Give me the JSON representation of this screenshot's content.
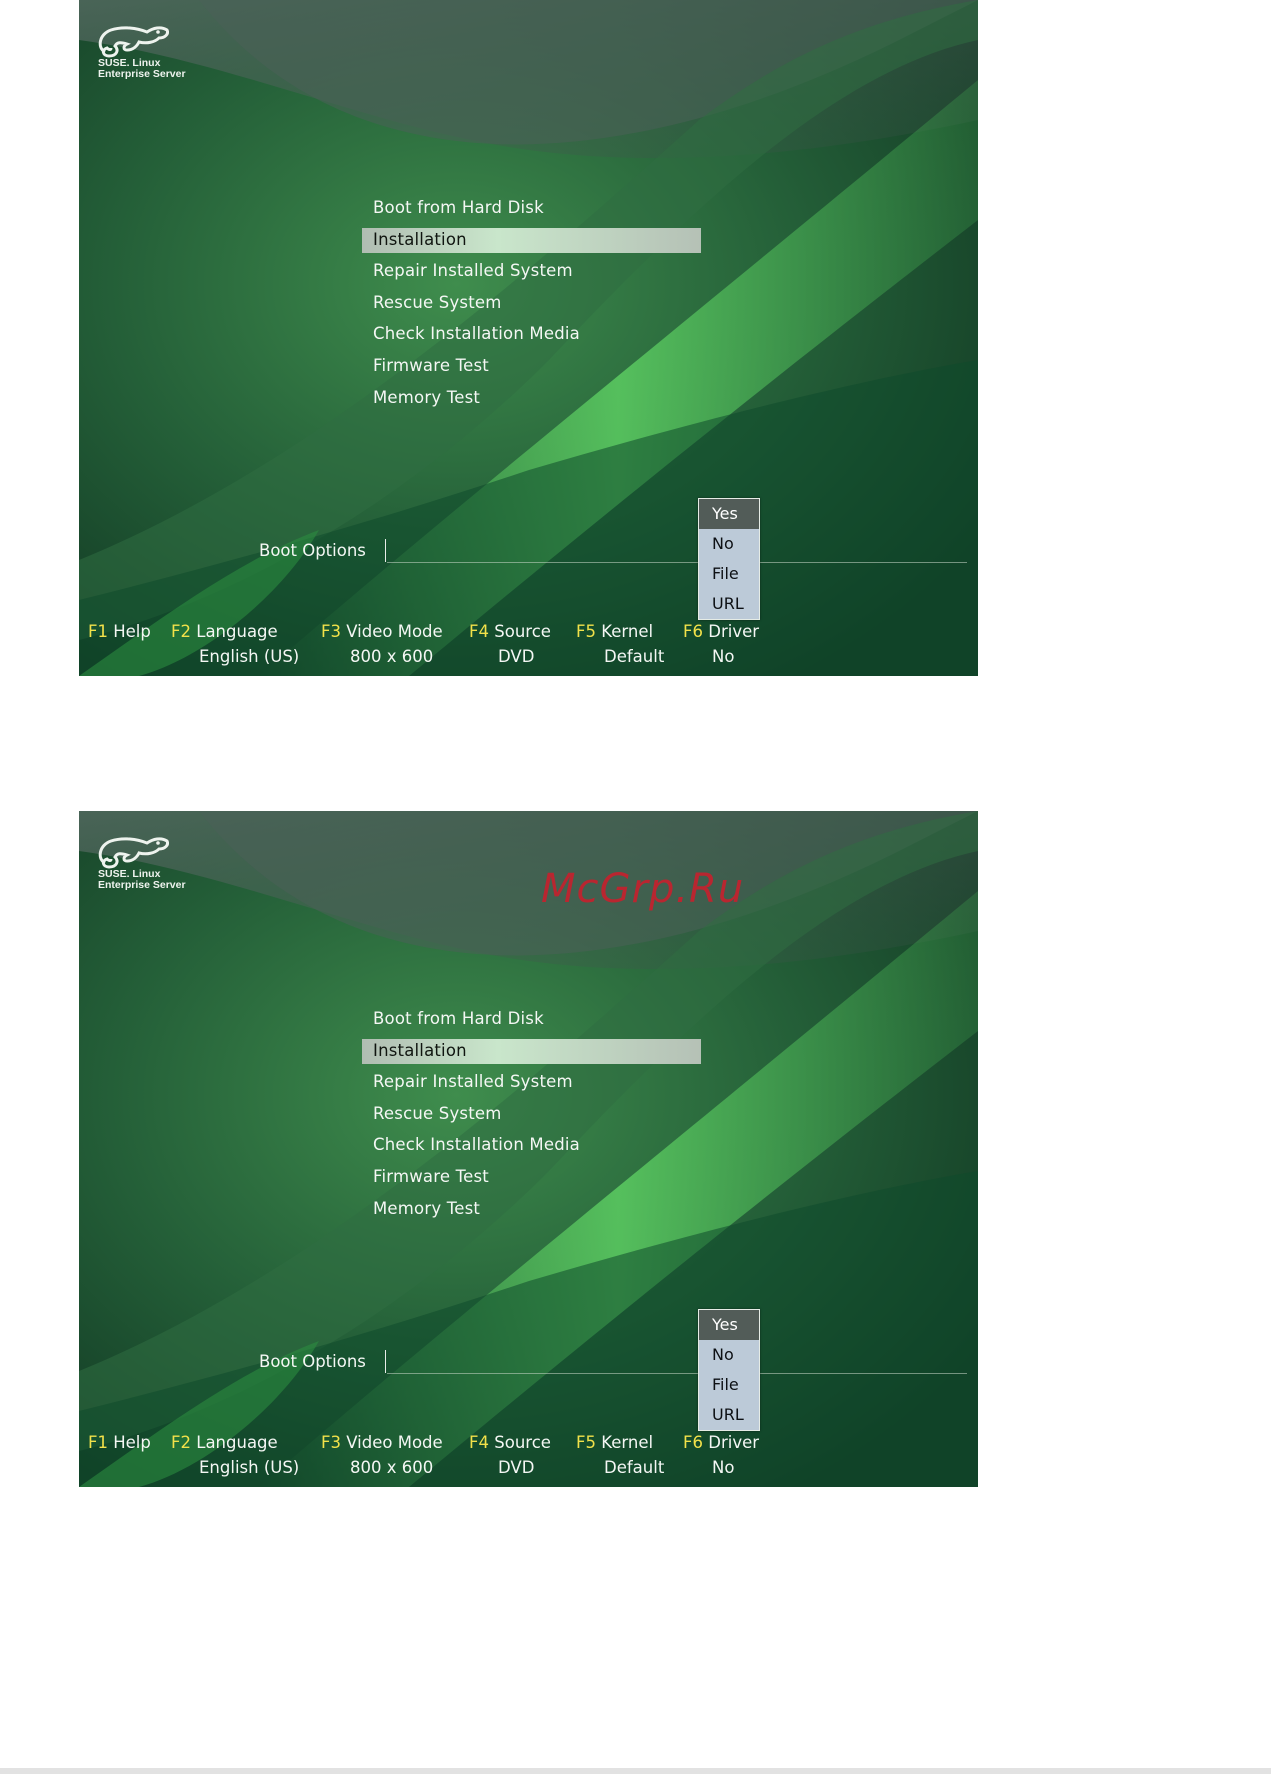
{
  "logo": {
    "line1": "SUSE. Linux",
    "line2": "Enterprise Server"
  },
  "menu": {
    "items": [
      {
        "label": "Boot from Hard Disk",
        "selected": false
      },
      {
        "label": "Installation",
        "selected": true
      },
      {
        "label": "Repair Installed System",
        "selected": false
      },
      {
        "label": "Rescue System",
        "selected": false
      },
      {
        "label": "Check Installation Media",
        "selected": false
      },
      {
        "label": "Firmware Test",
        "selected": false
      },
      {
        "label": "Memory Test",
        "selected": false
      }
    ]
  },
  "boot_options": {
    "label": "Boot Options",
    "value": ""
  },
  "driver_dropdown": {
    "options": [
      "Yes",
      "No",
      "File",
      "URL"
    ],
    "highlighted": "Yes"
  },
  "function_keys": [
    {
      "key": "F1",
      "name": "Help",
      "value": ""
    },
    {
      "key": "F2",
      "name": "Language",
      "value": "English (US)"
    },
    {
      "key": "F3",
      "name": "Video Mode",
      "value": "800 x 600"
    },
    {
      "key": "F4",
      "name": "Source",
      "value": "DVD"
    },
    {
      "key": "F5",
      "name": "Kernel",
      "value": "Default"
    },
    {
      "key": "F6",
      "name": "Driver",
      "value": "No"
    }
  ],
  "watermark": "McGrp.Ru",
  "colors": {
    "fkey": "#f2e14a",
    "text": "#f4f7f4",
    "selection": "#c9e6cb",
    "dropdown": "#bccad8"
  }
}
